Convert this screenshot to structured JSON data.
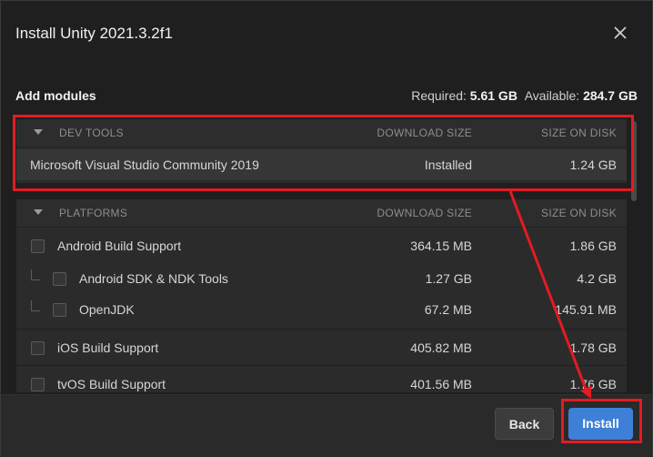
{
  "dialog": {
    "title": "Install Unity 2021.3.2f1"
  },
  "modules": {
    "heading": "Add modules",
    "required_label": "Required:",
    "required_value": "5.61 GB",
    "available_label": "Available:",
    "available_value": "284.7 GB"
  },
  "dev_tools": {
    "header": "DEV TOOLS",
    "col_download": "DOWNLOAD SIZE",
    "col_disk": "SIZE ON DISK",
    "rows": [
      {
        "name": "Microsoft Visual Studio Community 2019",
        "download": "Installed",
        "disk": "1.24 GB"
      }
    ]
  },
  "platforms": {
    "header": "PLATFORMS",
    "col_download": "DOWNLOAD SIZE",
    "col_disk": "SIZE ON DISK",
    "rows": [
      {
        "name": "Android Build Support",
        "download": "364.15 MB",
        "disk": "1.86 GB",
        "checked": false
      },
      {
        "name": "Android SDK & NDK Tools",
        "download": "1.27 GB",
        "disk": "4.2 GB",
        "checked": false
      },
      {
        "name": "OpenJDK",
        "download": "67.2 MB",
        "disk": "145.91 MB",
        "checked": false
      },
      {
        "name": "iOS Build Support",
        "download": "405.82 MB",
        "disk": "1.78 GB",
        "checked": false
      },
      {
        "name": "tvOS Build Support",
        "download": "401.56 MB",
        "disk": "1.76 GB",
        "checked": false
      }
    ]
  },
  "footer": {
    "back_label": "Back",
    "install_label": "Install"
  },
  "colors": {
    "accent": "#3e80d8",
    "highlight": "#e31b23",
    "background": "#1f1f1f"
  }
}
